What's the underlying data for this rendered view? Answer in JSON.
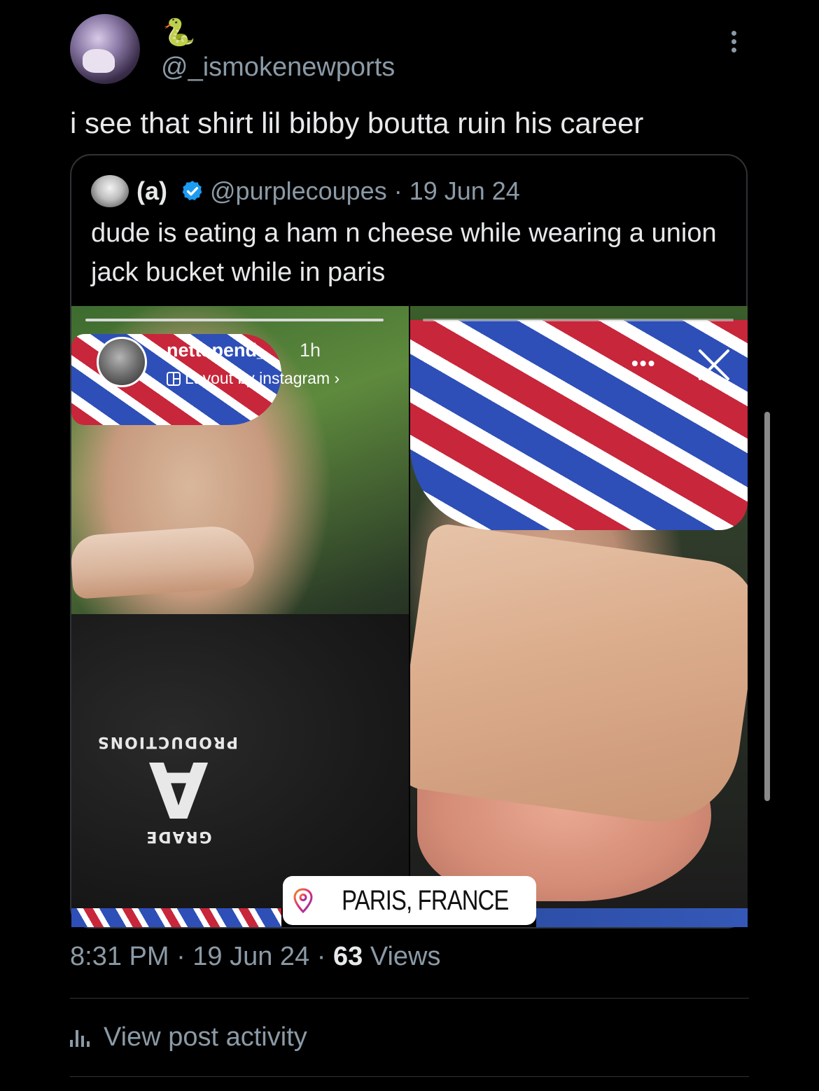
{
  "tweet": {
    "emoji": "🐍",
    "handle": "@_ismokenewports",
    "text": "i see that shirt lil bibby boutta ruin his career",
    "timestamp": "8:31 PM · 19 Jun 24 · ",
    "views_count": "63",
    "views_label": " Views",
    "activity_label": "View post activity"
  },
  "quoted": {
    "name": "(a)",
    "handle_date": "@purplecoupes · 19 Jun 24",
    "text": "dude is eating a ham n cheese while wearing a union jack bucket while in paris",
    "verified_color": "#1d9bf0"
  },
  "story": {
    "username": "nettspend_",
    "time": "1h",
    "layout_label": "Layout by instagram ›",
    "dots": "•••",
    "location": "PARIS, FRANCE",
    "shirt_text_top": "GRADE",
    "shirt_text_big": "A",
    "shirt_text_bottom": "PRODUCTIONS",
    "location_pin_color": "#d6249f"
  }
}
